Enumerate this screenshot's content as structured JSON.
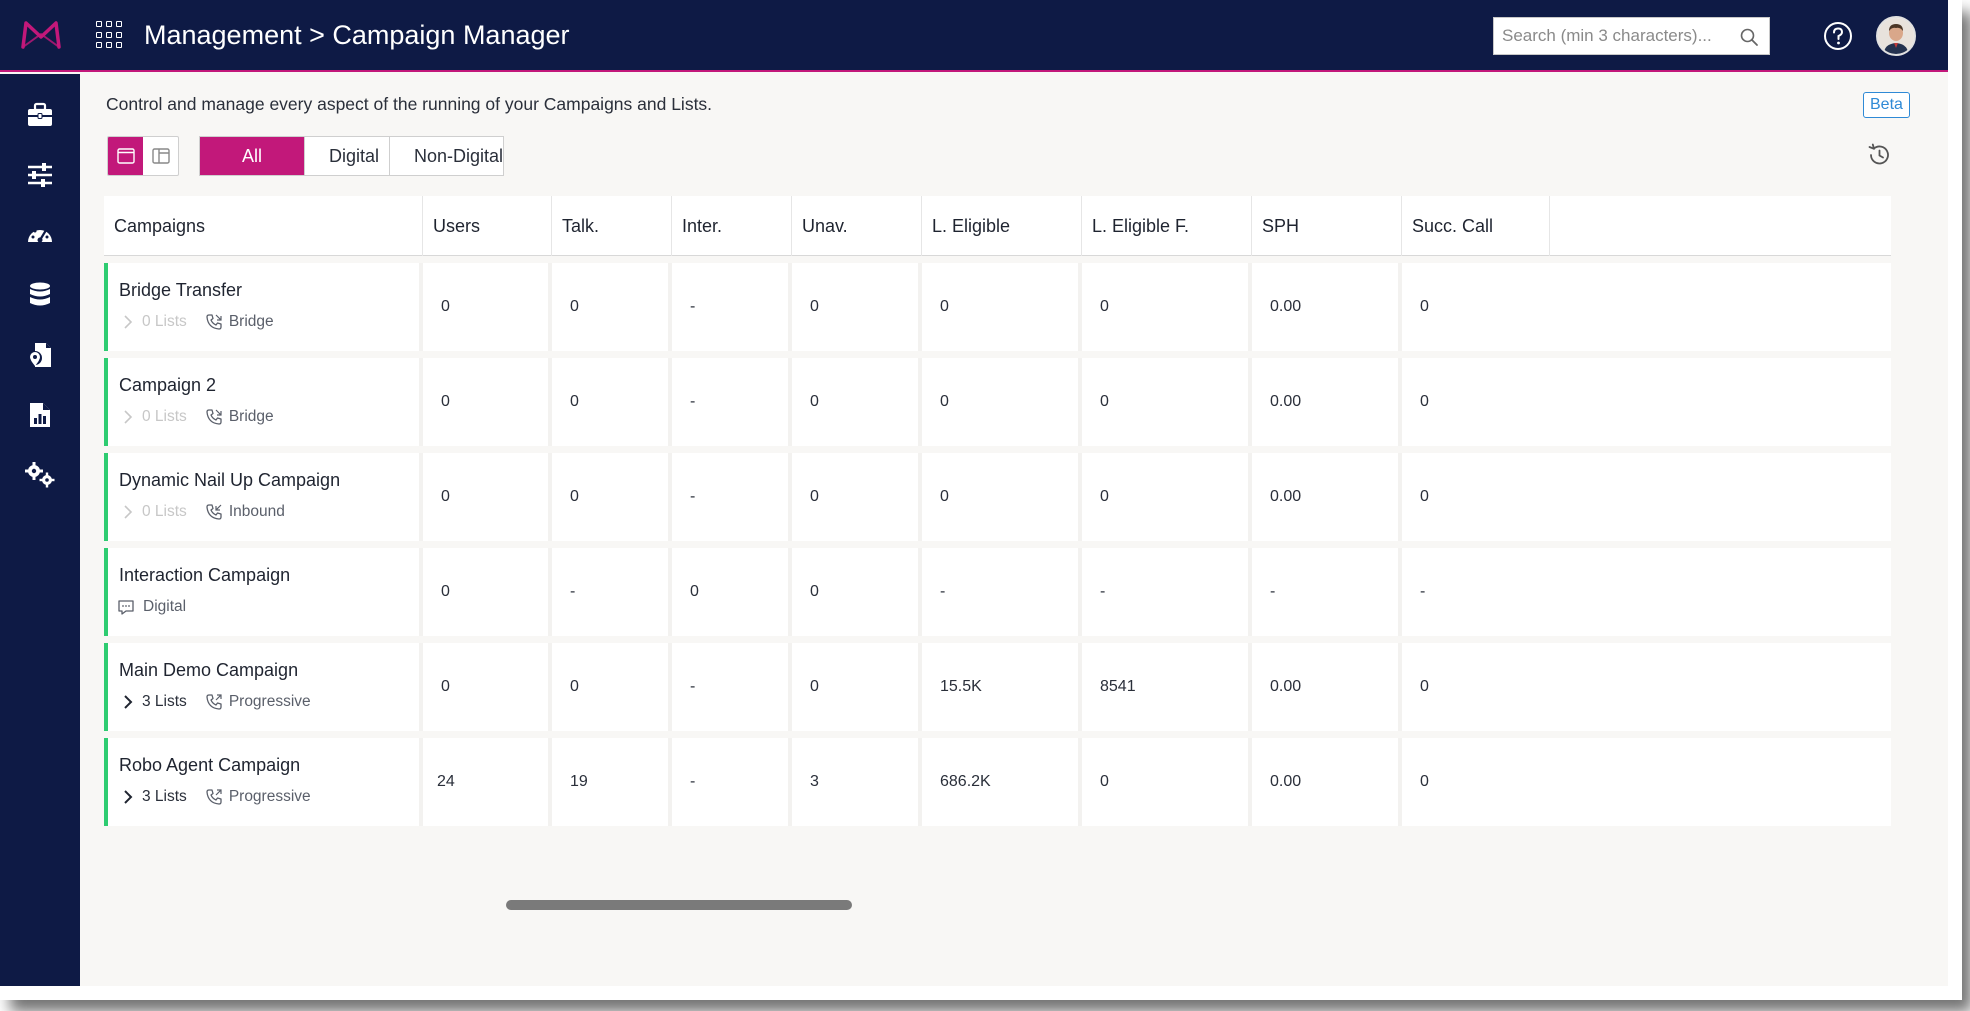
{
  "header": {
    "title": "Management > Campaign Manager",
    "search_placeholder": "Search (min 3 characters)..."
  },
  "sidebar": {
    "items": [
      {
        "icon": "briefcase-icon"
      },
      {
        "icon": "sliders-icon"
      },
      {
        "icon": "dashboard-gauge-icon"
      },
      {
        "icon": "database-icon"
      },
      {
        "icon": "document-location-icon"
      },
      {
        "icon": "report-chart-icon"
      },
      {
        "icon": "settings-gears-icon"
      }
    ]
  },
  "page": {
    "intro": "Control and manage every aspect of the running of your Campaigns and Lists.",
    "beta": "Beta"
  },
  "filters": [
    "All",
    "Digital",
    "Non-Digital"
  ],
  "colors": {
    "navy": "#0e1a45",
    "accent": "#c2187a",
    "status_green": "#2ecc71",
    "beta_blue": "#2f8ad6"
  },
  "table": {
    "columns": [
      "Campaigns",
      "Users",
      "Talk.",
      "Inter.",
      "Unav.",
      "L. Eligible",
      "L. Eligible F.",
      "SPH",
      "Succ. Call"
    ],
    "rows": [
      {
        "name": "Bridge Transfer",
        "lists": "0 Lists",
        "type": "Bridge",
        "users": "0",
        "talk": "0",
        "inter": "-",
        "unav": "0",
        "l_eligible": "0",
        "l_eligible_f": "0",
        "sph": "0.00",
        "succ_call": "0"
      },
      {
        "name": "Campaign 2",
        "lists": "0 Lists",
        "type": "Bridge",
        "users": "0",
        "talk": "0",
        "inter": "-",
        "unav": "0",
        "l_eligible": "0",
        "l_eligible_f": "0",
        "sph": "0.00",
        "succ_call": "0"
      },
      {
        "name": "Dynamic Nail Up Campaign",
        "lists": "0 Lists",
        "type": "Inbound",
        "users": "0",
        "talk": "0",
        "inter": "-",
        "unav": "0",
        "l_eligible": "0",
        "l_eligible_f": "0",
        "sph": "0.00",
        "succ_call": "0"
      },
      {
        "name": "Interaction Campaign",
        "lists": "",
        "type": "Digital",
        "users": "0",
        "talk": "-",
        "inter": "0",
        "unav": "0",
        "l_eligible": "-",
        "l_eligible_f": "-",
        "sph": "-",
        "succ_call": "-"
      },
      {
        "name": "Main Demo Campaign",
        "lists": "3 Lists",
        "type": "Progressive",
        "users": "0",
        "talk": "0",
        "inter": "-",
        "unav": "0",
        "l_eligible": "15.5K",
        "l_eligible_f": "8541",
        "sph": "0.00",
        "succ_call": "0"
      },
      {
        "name": "Robo Agent Campaign",
        "lists": "3 Lists",
        "type": "Progressive",
        "users": "24",
        "talk": "19",
        "inter": "-",
        "unav": "3",
        "l_eligible": "686.2K",
        "l_eligible_f": "0",
        "sph": "0.00",
        "succ_call": "0"
      }
    ]
  }
}
